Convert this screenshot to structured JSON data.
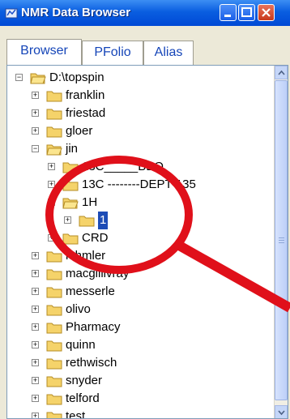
{
  "window": {
    "title": "NMR Data Browser",
    "accent": "#0a5ee0"
  },
  "tabs": [
    {
      "label": "Browser",
      "active": true
    },
    {
      "label": "PFolio",
      "active": false
    },
    {
      "label": "Alias",
      "active": false
    }
  ],
  "tree": {
    "root": {
      "label": "D:\\topspin",
      "expander": "⊟"
    },
    "items": [
      {
        "label": "franklin",
        "expander": "⊞"
      },
      {
        "label": "friestad",
        "expander": "⊞"
      },
      {
        "label": "gloer",
        "expander": "⊞"
      },
      {
        "label": "jin",
        "expander": "⊟"
      },
      {
        "label": "13C_____BBO",
        "expander": "⊞"
      },
      {
        "label": "13C --------DEPT-135",
        "expander": "⊞"
      },
      {
        "label": "1H",
        "expander": "⊟"
      },
      {
        "label": "1",
        "expander": "⊞",
        "selected": true
      },
      {
        "label": "CRD",
        "expander": "⊞"
      },
      {
        "label": "lehmler",
        "expander": "⊞"
      },
      {
        "label": "macgillivray",
        "expander": "⊞"
      },
      {
        "label": "messerle",
        "expander": "⊞"
      },
      {
        "label": "olivo",
        "expander": "⊞"
      },
      {
        "label": "Pharmacy",
        "expander": "⊞"
      },
      {
        "label": "quinn",
        "expander": "⊞"
      },
      {
        "label": "rethwisch",
        "expander": "⊞"
      },
      {
        "label": "snyder",
        "expander": "⊞"
      },
      {
        "label": "telford",
        "expander": "⊞"
      },
      {
        "label": "test",
        "expander": "⊞"
      }
    ]
  },
  "colors": {
    "folder": "#f5d36a",
    "selection": "#1d4cb6",
    "annotation": "#e0101a"
  }
}
